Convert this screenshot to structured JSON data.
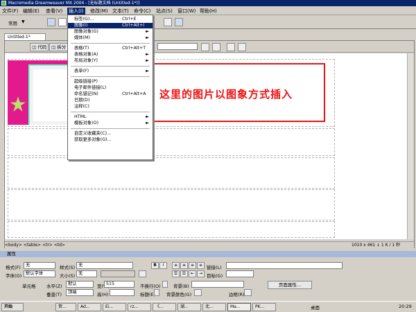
{
  "window": {
    "title": "Macromedia Dreamweaver MX 2004 - [无标题文档 (Untitled-1*)]"
  },
  "menubar": {
    "items": [
      "文件(F)",
      "编辑(E)",
      "查看(V)",
      "插入(I)",
      "修改(M)",
      "文本(T)",
      "命令(C)",
      "站点(S)",
      "窗口(W)",
      "帮助(H)"
    ],
    "active_index": 3
  },
  "insertbar": {
    "category": "常用"
  },
  "document": {
    "tab_label": "Untitled-1*",
    "toolbar": {
      "code": "代码",
      "split": "拆分"
    },
    "status_path": "<body> <table> <tr> <td>",
    "status_right": "1010 x 461 ↓ 1 K / 1 秒"
  },
  "insert_menu": {
    "items": [
      {
        "label": "标签(G)...",
        "shortcut": "Ctrl+E"
      },
      {
        "label": "图像(I)",
        "shortcut": "Ctrl+Alt+I",
        "highlighted": true
      },
      {
        "label": "图像对象(G)",
        "submenu": true
      },
      {
        "label": "媒体(M)",
        "submenu": true
      },
      {
        "sep": true
      },
      {
        "label": "表格(T)",
        "shortcut": "Ctrl+Alt+T"
      },
      {
        "label": "表格对象(A)",
        "submenu": true
      },
      {
        "label": "布局对象(Y)",
        "submenu": true
      },
      {
        "sep": true
      },
      {
        "label": "表单(F)",
        "submenu": true
      },
      {
        "sep": true
      },
      {
        "label": "超级链接(P)"
      },
      {
        "label": "电子邮件链接(L)"
      },
      {
        "label": "命名锚记(N)",
        "shortcut": "Ctrl+Alt+A"
      },
      {
        "label": "日期(D)"
      },
      {
        "label": "注释(C)"
      },
      {
        "sep": true
      },
      {
        "label": "HTML",
        "submenu": true
      },
      {
        "label": "模板对象(O)",
        "submenu": true
      },
      {
        "sep": true
      },
      {
        "label": "自定义收藏夹(C)..."
      },
      {
        "label": "获取更多对象(G)..."
      }
    ]
  },
  "annotation": {
    "text": "这里的图片以图象方式插入",
    "color": "#e11111"
  },
  "properties": {
    "header": "属性",
    "format_label": "格式(F)",
    "format_value": "无",
    "style_label": "样式(S)",
    "style_value": "无",
    "link_label": "链接(L)",
    "font_label": "字体(O)",
    "font_value": "默认字体",
    "size_label": "大小(S)",
    "size_value": "无",
    "target_label": "目标(G)",
    "cell_label": "单元格",
    "horz_label": "水平(Z)",
    "horz_value": "默认",
    "width_label": "宽(W)",
    "width_value": "515",
    "nowrap_label": "不换行(O)",
    "bg_label": "背景(B)",
    "page_props": "页面属性...",
    "vert_label": "垂直(T)",
    "vert_value": "顶端",
    "height_label": "高(H)",
    "header_label": "标题(E)",
    "bgcolor_label": "背景颜色(G)",
    "border_label": "边框(R)"
  },
  "taskbar": {
    "start": "开始",
    "items": [
      "贺...",
      "Ad...",
      "Ei...",
      "rz...",
      "《...",
      "湖...",
      "北...",
      "Ma...",
      "PK..."
    ],
    "active_index": 7,
    "tray_label": "桌面",
    "clock": "20:29"
  },
  "colors": {
    "accent": "#0a246a",
    "callout": "#e11111",
    "image_bg": "#e21a8d"
  }
}
